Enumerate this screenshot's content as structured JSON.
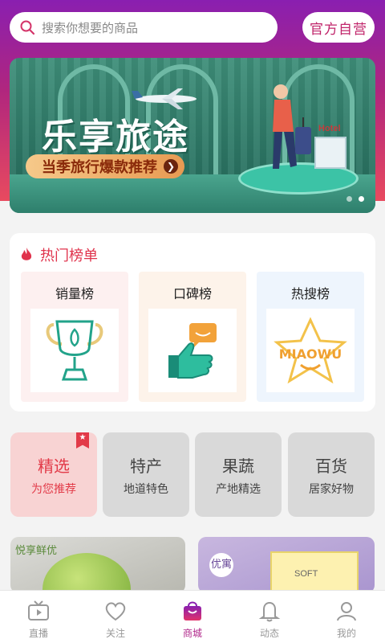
{
  "search": {
    "placeholder": "搜索你想要的商品"
  },
  "official_button": "官方自营",
  "banner": {
    "title": "乐享旅途",
    "subtitle": "当季旅行爆款推荐",
    "hotel_sign": "Hotel"
  },
  "rankings": {
    "title": "热门榜单",
    "items": [
      {
        "label": "销量榜",
        "bg": "#fdf0f0"
      },
      {
        "label": "口碑榜",
        "bg": "#fdf3ea"
      },
      {
        "label": "热搜榜",
        "bg": "#eef5fd"
      }
    ],
    "logo_text": "MIAOWU"
  },
  "categories": [
    {
      "title": "精选",
      "subtitle": "为您推荐",
      "selected": true
    },
    {
      "title": "特产",
      "subtitle": "地道特色",
      "selected": false
    },
    {
      "title": "果蔬",
      "subtitle": "产地精选",
      "selected": false
    },
    {
      "title": "百货",
      "subtitle": "居家好物",
      "selected": false
    }
  ],
  "products": [
    {
      "caption": "悦享鲜优"
    },
    {
      "caption": "优寓",
      "box_text": "SOFT"
    }
  ],
  "tabbar": [
    {
      "label": "直播",
      "icon": "tv-icon",
      "active": false
    },
    {
      "label": "关注",
      "icon": "heart-icon",
      "active": false
    },
    {
      "label": "商城",
      "icon": "shopping-bag-icon",
      "active": true
    },
    {
      "label": "动态",
      "icon": "bell-icon",
      "active": false
    },
    {
      "label": "我的",
      "icon": "user-icon",
      "active": false
    }
  ],
  "colors": {
    "accent": "#b0268a",
    "hot_red": "#e0334c",
    "selected_bg": "#f8d3d3"
  }
}
